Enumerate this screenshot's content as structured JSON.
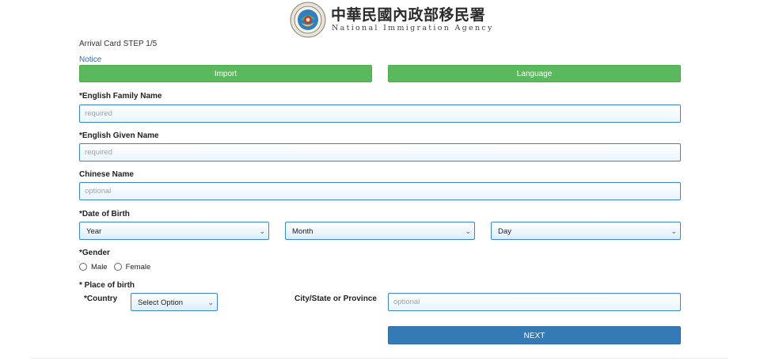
{
  "header": {
    "logo_icon": "seal-logo-icon",
    "agency_cn": "中華民國內政部移民署",
    "agency_en": "National Immigration Agency"
  },
  "step": "Arrival Card STEP 1/5",
  "notice": "Notice",
  "buttons": {
    "import": "Import",
    "language": "Language",
    "next": "NEXT"
  },
  "fields": {
    "family_name": {
      "label": "*English Family Name",
      "placeholder": "required"
    },
    "given_name": {
      "label": "*English Given Name",
      "placeholder": "required"
    },
    "chinese_name": {
      "label": "Chinese Name",
      "placeholder": "optional"
    }
  },
  "dob": {
    "label": "*Date of Birth",
    "year": "Year",
    "month": "Month",
    "day": "Day",
    "chevron_icon": "chevron-down-icon"
  },
  "gender": {
    "label": "*Gender",
    "options": [
      "Male",
      "Female"
    ]
  },
  "birth_place": {
    "label": "* Place of birth",
    "country_label": "*Country",
    "country_value": "Select Option",
    "city_label": "City/State or Province",
    "city_placeholder": "optional"
  },
  "colors": {
    "green": "#5cb85c",
    "blue": "#337ab7",
    "input_border": "#3a86c8",
    "link": "#2a6fb6"
  }
}
